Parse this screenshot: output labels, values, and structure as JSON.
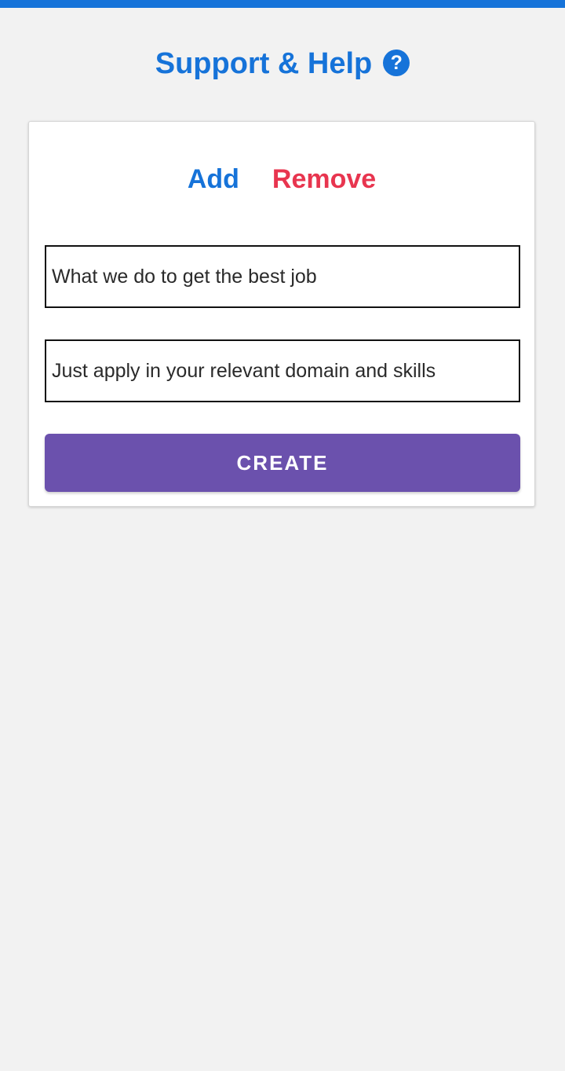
{
  "header": {
    "title": "Support & Help",
    "help_icon": "question-circle-icon",
    "help_glyph": "?"
  },
  "tabs": {
    "add_label": "Add",
    "remove_label": "Remove"
  },
  "form": {
    "question_value": "What we do to get the best job",
    "answer_value": "Just apply in your relevant domain and skills",
    "create_label": "CREATE"
  },
  "colors": {
    "accent_blue": "#1673d9",
    "remove_red": "#e8354f",
    "button_purple": "#6b51ad",
    "background": "#f2f2f2"
  }
}
